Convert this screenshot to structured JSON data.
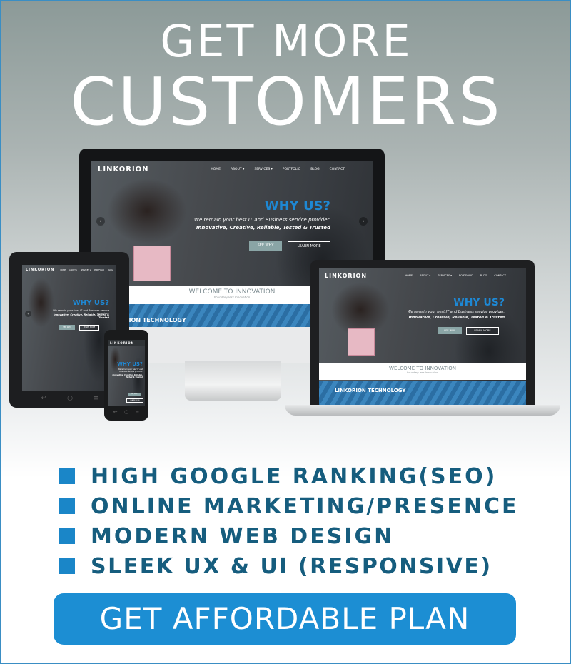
{
  "headline": {
    "line1": "GET MORE",
    "line2": "CUSTOMERS"
  },
  "site": {
    "logo": "LINKORION",
    "logo_sub": "TECHNOLOGY",
    "nav": [
      "HOME",
      "ABOUT ▾",
      "SERVICES ▾",
      "PORTFOLIO",
      "BLOG",
      "CONTACT"
    ],
    "hero_title": "WHY US?",
    "hero_tagline": "We remain your best IT and Business service provider.",
    "hero_values": "Innovative, Creative, Reliable, Tested & Trusted",
    "btn_primary": "SEE WHY",
    "btn_secondary": "LEARN MORE",
    "welcome_title": "WELCOME TO INNOVATION",
    "welcome_sub": "boundary-less Innovation",
    "band_title": "LINKORION TECHNOLOGY"
  },
  "features": [
    "HIGH GOOGLE RANKING(SEO)",
    "ONLINE MARKETING/PRESENCE",
    "MODERN WEB DESIGN",
    "SLEEK UX & UI (RESPONSIVE)"
  ],
  "cta": {
    "label": "GET AFFORDABLE PLAN"
  },
  "colors": {
    "accent": "#1c8ed3",
    "feature_text": "#165d7e",
    "hero_title": "#1e88d4"
  }
}
